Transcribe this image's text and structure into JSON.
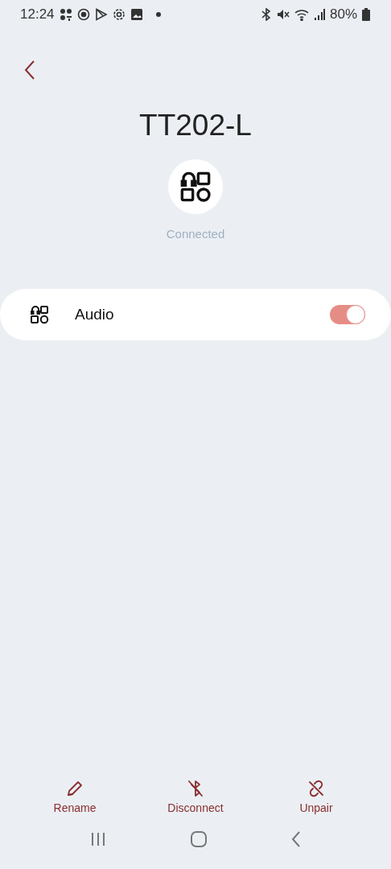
{
  "status_bar": {
    "time": "12:24",
    "battery": "80%"
  },
  "title": "TT202-L",
  "device": {
    "status": "Connected"
  },
  "settings": [
    {
      "label": "Audio",
      "on": true
    }
  ],
  "actions": [
    {
      "kind": "rename",
      "label": "Rename"
    },
    {
      "kind": "disconnect",
      "label": "Disconnect"
    },
    {
      "kind": "unpair",
      "label": "Unpair"
    }
  ]
}
